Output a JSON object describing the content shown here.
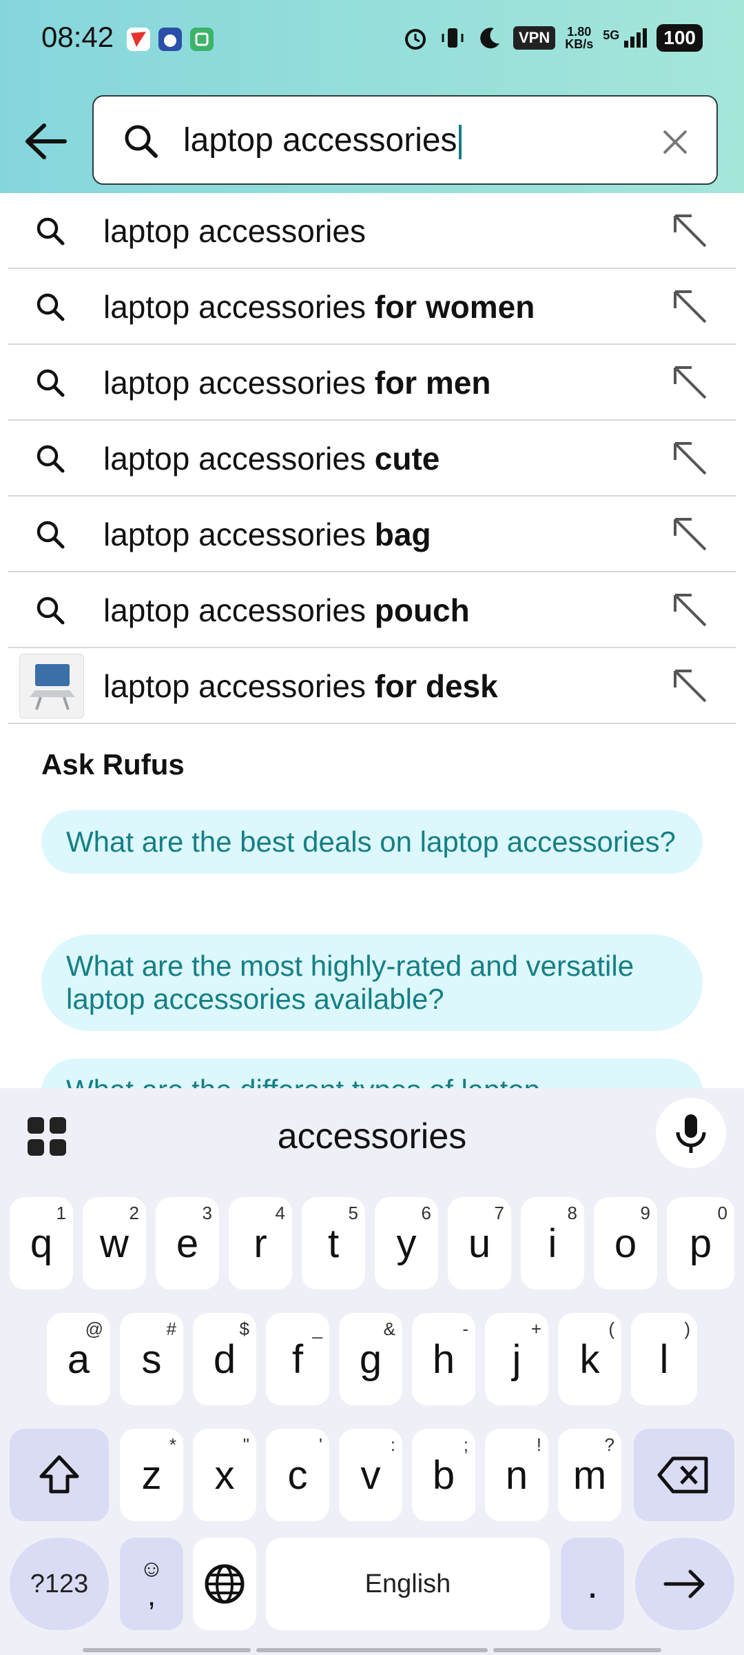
{
  "status_bar": {
    "time": "08:42",
    "vpn": "VPN",
    "speed_value": "1.80",
    "speed_unit": "KB/s",
    "network": "5G",
    "battery": "100"
  },
  "search": {
    "query": "laptop accessories"
  },
  "suggestions": [
    {
      "prefix": "laptop accessories",
      "suffix": ""
    },
    {
      "prefix": "laptop accessories ",
      "suffix": "for women"
    },
    {
      "prefix": "laptop accessories ",
      "suffix": "for men"
    },
    {
      "prefix": "laptop accessories ",
      "suffix": "cute"
    },
    {
      "prefix": "laptop accessories ",
      "suffix": "bag"
    },
    {
      "prefix": "laptop accessories ",
      "suffix": "pouch"
    },
    {
      "prefix": "laptop accessories ",
      "suffix": "for desk"
    }
  ],
  "rufus": {
    "title": "Ask Rufus",
    "questions": [
      "What are the best deals on laptop accessories?",
      "What are the most highly-rated and versatile laptop accessories available?",
      "What are the different types of laptop"
    ]
  },
  "keyboard": {
    "suggestion": "accessories",
    "row1": [
      {
        "k": "q",
        "s": "1"
      },
      {
        "k": "w",
        "s": "2"
      },
      {
        "k": "e",
        "s": "3"
      },
      {
        "k": "r",
        "s": "4"
      },
      {
        "k": "t",
        "s": "5"
      },
      {
        "k": "y",
        "s": "6"
      },
      {
        "k": "u",
        "s": "7"
      },
      {
        "k": "i",
        "s": "8"
      },
      {
        "k": "o",
        "s": "9"
      },
      {
        "k": "p",
        "s": "0"
      }
    ],
    "row2": [
      {
        "k": "a",
        "s": "@"
      },
      {
        "k": "s",
        "s": "#"
      },
      {
        "k": "d",
        "s": "$"
      },
      {
        "k": "f",
        "s": "_"
      },
      {
        "k": "g",
        "s": "&"
      },
      {
        "k": "h",
        "s": "-"
      },
      {
        "k": "j",
        "s": "+"
      },
      {
        "k": "k",
        "s": "("
      },
      {
        "k": "l",
        "s": ")"
      }
    ],
    "row3": [
      {
        "k": "z",
        "s": "*"
      },
      {
        "k": "x",
        "s": "\""
      },
      {
        "k": "c",
        "s": "'"
      },
      {
        "k": "v",
        "s": ":"
      },
      {
        "k": "b",
        "s": ";"
      },
      {
        "k": "n",
        "s": "!"
      },
      {
        "k": "m",
        "s": "?"
      }
    ],
    "symbols_label": "?123",
    "comma_label": ",",
    "space_label": "English",
    "period_label": "."
  },
  "colors": {
    "header_start": "#85d6dc",
    "header_end": "#a5e6d9",
    "rufus_pill_bg": "#dcf8fc",
    "rufus_text": "#157f85",
    "keyboard_bg": "#eff0f7"
  }
}
